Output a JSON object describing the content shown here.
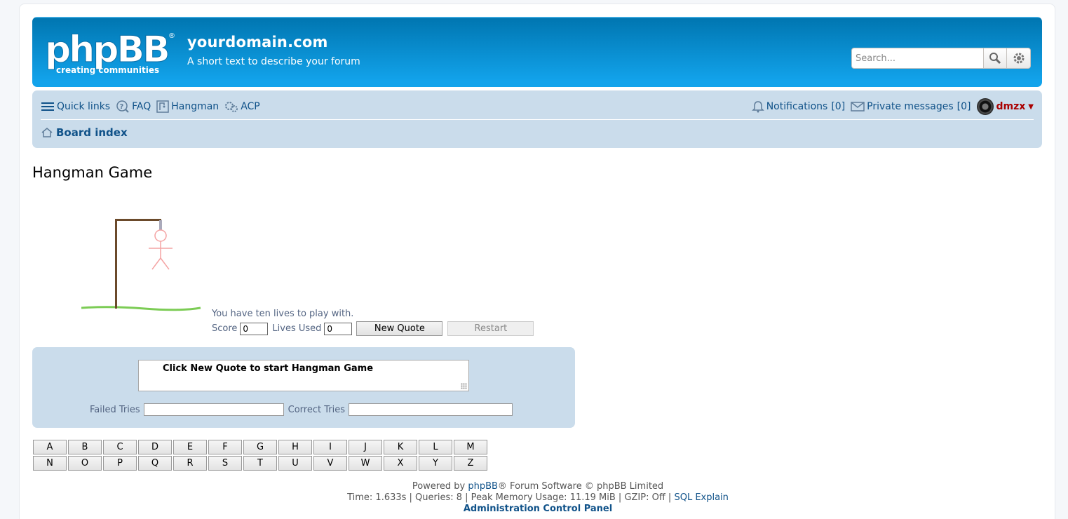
{
  "header": {
    "logo_text": "phpBB",
    "logo_tagline": "creating communities",
    "site_title": "yourdomain.com",
    "site_description": "A short text to describe your forum",
    "search_placeholder": "Search..."
  },
  "nav": {
    "quick_links": "Quick links",
    "faq": "FAQ",
    "hangman": "Hangman",
    "acp": "ACP",
    "notifications": "Notifications",
    "notifications_count": "[0]",
    "private_messages": "Private messages",
    "pm_count": "[0]",
    "username": "dmzx",
    "caret": "▼",
    "board_index": "Board index"
  },
  "game": {
    "title": "Hangman Game",
    "info": "You have ten lives to play with.",
    "score_label": "Score",
    "score_value": "0",
    "lives_label": "Lives Used",
    "lives_value": "0",
    "new_quote": "New Quote",
    "restart": "Restart",
    "quote_text": "Click New Quote to start Hangman Game",
    "failed_label": "Failed Tries",
    "correct_label": "Correct Tries",
    "letters": [
      "A",
      "B",
      "C",
      "D",
      "E",
      "F",
      "G",
      "H",
      "I",
      "J",
      "K",
      "L",
      "M",
      "N",
      "O",
      "P",
      "Q",
      "R",
      "S",
      "T",
      "U",
      "V",
      "W",
      "X",
      "Y",
      "Z"
    ]
  },
  "footer": {
    "powered_prefix": "Powered by",
    "powered_link": "phpBB",
    "powered_suffix": "® Forum Software © phpBB Limited",
    "stats": "Time: 1.633s | Queries: 8 | Peak Memory Usage: 11.19 MiB | GZIP: Off |",
    "sql_explain": "SQL Explain",
    "acp_link": "Administration Control Panel"
  },
  "colors": {
    "header_blue": "#12a3eb",
    "nav_bg": "#cadceb",
    "link": "#105289",
    "username": "#aa0000"
  }
}
